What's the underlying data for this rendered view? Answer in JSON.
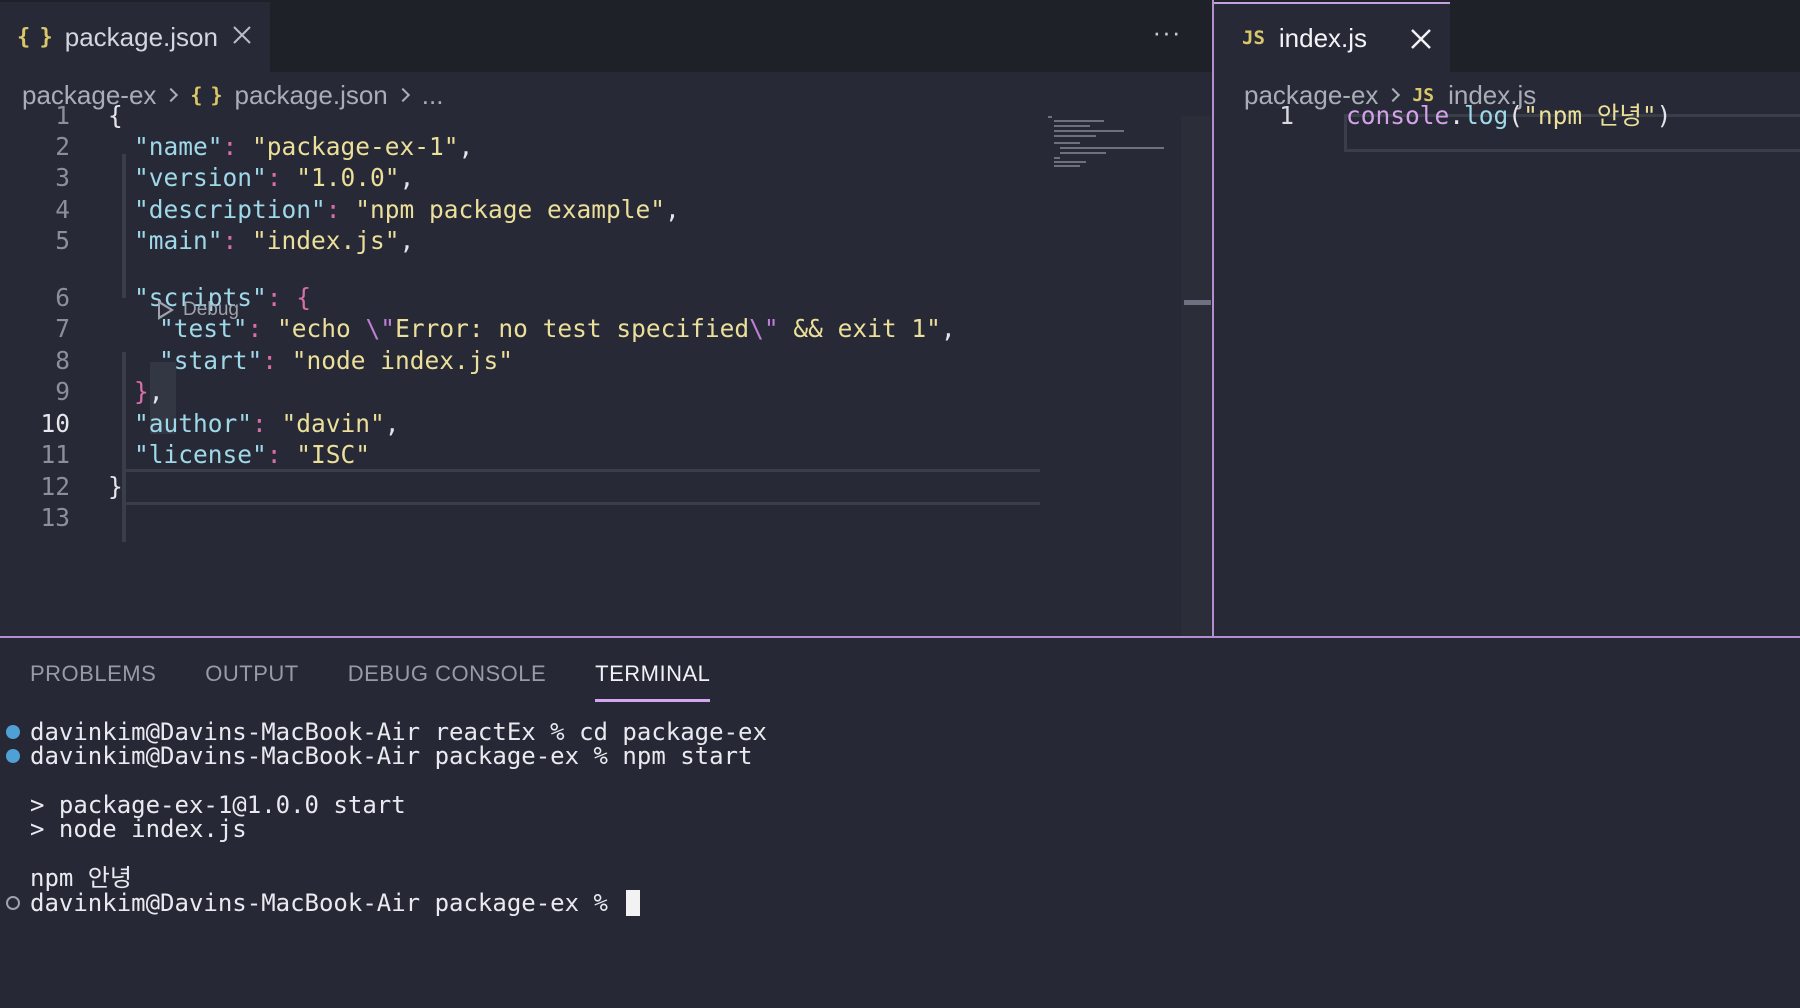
{
  "left_editor": {
    "tab": {
      "icon": "json-braces-icon",
      "icon_text": "{ }",
      "label": "package.json"
    },
    "more_label": "···",
    "breadcrumb": {
      "folder": "package-ex",
      "file_icon_text": "{ }",
      "file": "package.json",
      "tail": "..."
    },
    "codelens_label": "Debug",
    "active_line": 10,
    "lines": [
      {
        "n": "1",
        "parts": [
          {
            "c": "w",
            "t": "{"
          }
        ]
      },
      {
        "n": "2",
        "parts": [
          {
            "c": "k",
            "t": "\"name\""
          },
          {
            "c": "p",
            "t": ": "
          },
          {
            "c": "s",
            "t": "\"package-ex-1\""
          },
          {
            "c": "w",
            "t": ","
          }
        ]
      },
      {
        "n": "3",
        "parts": [
          {
            "c": "k",
            "t": "\"version\""
          },
          {
            "c": "p",
            "t": ": "
          },
          {
            "c": "s",
            "t": "\"1.0.0\""
          },
          {
            "c": "w",
            "t": ","
          }
        ]
      },
      {
        "n": "4",
        "parts": [
          {
            "c": "k",
            "t": "\"description\""
          },
          {
            "c": "p",
            "t": ": "
          },
          {
            "c": "s",
            "t": "\"npm package example\""
          },
          {
            "c": "w",
            "t": ","
          }
        ]
      },
      {
        "n": "5",
        "parts": [
          {
            "c": "k",
            "t": "\"main\""
          },
          {
            "c": "p",
            "t": ": "
          },
          {
            "c": "s",
            "t": "\"index.js\""
          },
          {
            "c": "w",
            "t": ","
          }
        ]
      },
      {
        "n": "6",
        "parts": [
          {
            "c": "k",
            "t": "\"scripts\""
          },
          {
            "c": "p",
            "t": ": {"
          }
        ]
      },
      {
        "n": "7",
        "parts": [
          {
            "c": "k",
            "t": "\"test\""
          },
          {
            "c": "p",
            "t": ": "
          },
          {
            "c": "s",
            "t": "\"echo "
          },
          {
            "c": "e",
            "t": "\\\""
          },
          {
            "c": "s",
            "t": "Error: no test specified"
          },
          {
            "c": "e",
            "t": "\\\""
          },
          {
            "c": "s",
            "t": " && exit 1\""
          },
          {
            "c": "w",
            "t": ","
          }
        ]
      },
      {
        "n": "8",
        "parts": [
          {
            "c": "k",
            "t": "\"start\""
          },
          {
            "c": "p",
            "t": ": "
          },
          {
            "c": "s",
            "t": "\"node index.js\""
          }
        ]
      },
      {
        "n": "9",
        "parts": [
          {
            "c": "p",
            "t": "}"
          },
          {
            "c": "w",
            "t": ","
          }
        ]
      },
      {
        "n": "10",
        "parts": [
          {
            "c": "k",
            "t": "\"author\""
          },
          {
            "c": "p",
            "t": ": "
          },
          {
            "c": "s",
            "t": "\"davin\""
          },
          {
            "c": "w",
            "t": ","
          }
        ]
      },
      {
        "n": "11",
        "parts": [
          {
            "c": "k",
            "t": "\"license\""
          },
          {
            "c": "p",
            "t": ": "
          },
          {
            "c": "s",
            "t": "\"ISC\""
          }
        ]
      },
      {
        "n": "12",
        "parts": [
          {
            "c": "w",
            "t": "}"
          }
        ]
      },
      {
        "n": "13",
        "parts": []
      }
    ]
  },
  "right_editor": {
    "tab": {
      "icon": "javascript-icon",
      "icon_text": "JS",
      "label": "index.js"
    },
    "breadcrumb": {
      "folder": "package-ex",
      "file_icon_text": "JS",
      "file": "index.js"
    },
    "lines": [
      {
        "n": "1",
        "parts": [
          {
            "c": "obj",
            "t": "console"
          },
          {
            "c": "w",
            "t": "."
          },
          {
            "c": "fn",
            "t": "log"
          },
          {
            "c": "w",
            "t": "("
          },
          {
            "c": "s",
            "t": "\"npm 안녕\""
          },
          {
            "c": "w",
            "t": ")"
          }
        ]
      }
    ]
  },
  "panel": {
    "tabs": [
      "PROBLEMS",
      "OUTPUT",
      "DEBUG CONSOLE",
      "TERMINAL"
    ],
    "active_tab": "TERMINAL",
    "terminal": [
      {
        "marker": "filled",
        "text": "davinkim@Davins-MacBook-Air reactEx % cd package-ex"
      },
      {
        "marker": "filled",
        "text": "davinkim@Davins-MacBook-Air package-ex % npm start"
      },
      {
        "marker": "none",
        "text": ""
      },
      {
        "marker": "none",
        "text": "> package-ex-1@1.0.0 start"
      },
      {
        "marker": "none",
        "text": "> node index.js"
      },
      {
        "marker": "none",
        "text": ""
      },
      {
        "marker": "none",
        "text": "npm 안녕"
      },
      {
        "marker": "hollow",
        "text": "davinkim@Davins-MacBook-Air package-ex % ",
        "cursor": true
      }
    ]
  },
  "colors": {
    "editor_bg": "#272a36",
    "tab_bar_bg": "#1f2129",
    "accent_border": "#b48fd0",
    "json_key": "#9fd8e8",
    "string": "#ecdf9a",
    "punctuation": "#d86fa6",
    "terminal_success_dot": "#4fa0d4"
  }
}
